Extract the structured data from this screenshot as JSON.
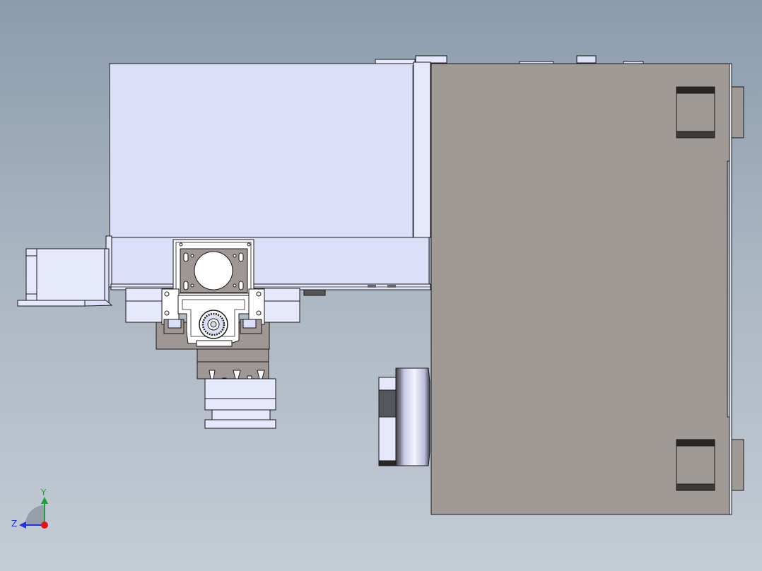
{
  "viewport": {
    "background_top": "#8b9cad",
    "background_bottom": "#c4ccd5"
  },
  "colors": {
    "blue_body": "#dcdff8",
    "blue_body_light": "#e6e8fb",
    "blue_shade": "#c9cdee",
    "gray_body": "#a09a97",
    "gray_plate": "#9e9794",
    "dark": "#2a2624",
    "edge": "#1a1a1a",
    "x_axis": "#e0141b",
    "y_axis": "#1fa035",
    "z_axis": "#2233dd"
  },
  "triad": {
    "y_label": "Y",
    "z_label": "Z"
  }
}
